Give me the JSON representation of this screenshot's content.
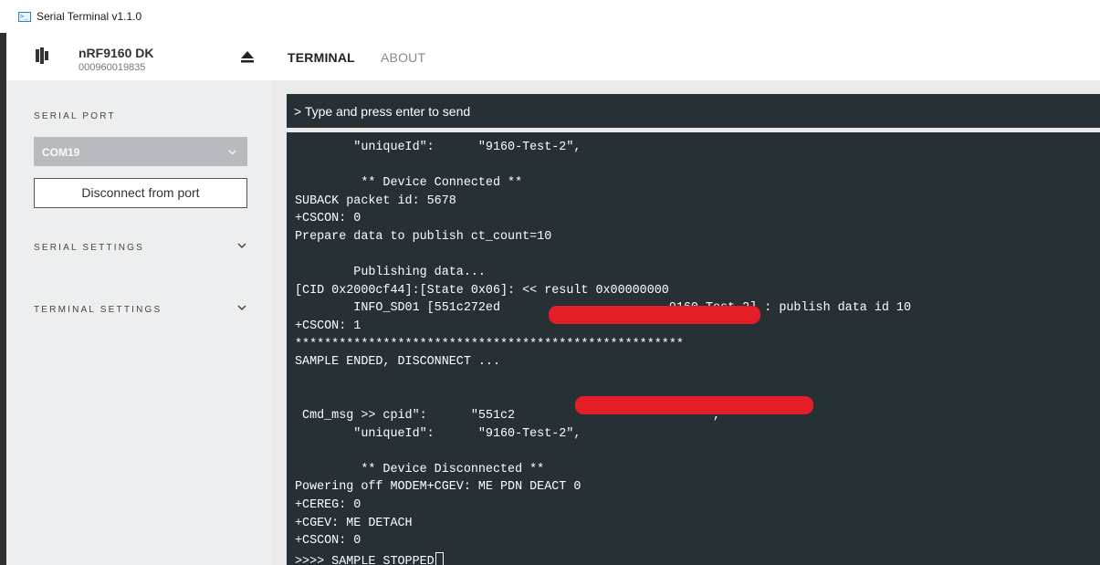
{
  "window": {
    "title": "Serial Terminal v1.1.0"
  },
  "device": {
    "name": "nRF9160 DK",
    "serial": "000960019835"
  },
  "tabs": [
    {
      "label": "TERMINAL",
      "active": true
    },
    {
      "label": "ABOUT",
      "active": false
    }
  ],
  "sidebar": {
    "serial_port_label": "SERIAL PORT",
    "port_value": "COM19",
    "disconnect_label": "Disconnect from port",
    "serial_settings_label": "SERIAL SETTINGS",
    "terminal_settings_label": "TERMINAL SETTINGS"
  },
  "terminal": {
    "input_placeholder": "> Type and press enter to send",
    "lines": [
      "        \"uniqueId\":      \"9160-Test-2\",",
      "",
      "         ** Device Connected **",
      "SUBACK packet id: 5678",
      "+CSCON: 0",
      "Prepare data to publish ct_count=10",
      "",
      "        Publishing data...",
      "[CID 0x2000cf44]:[State 0x06]: << result 0x00000000",
      "        INFO_SD01 [551c272ed                       9160-Test-2] : publish data id 10",
      "+CSCON: 1",
      "*****************************************************",
      "SAMPLE ENDED, DISCONNECT ...",
      "",
      "",
      " Cmd_msg >> cpid\":      \"551c2                          \",",
      "        \"uniqueId\":      \"9160-Test-2\",",
      "",
      "         ** Device Disconnected **",
      "Powering off MODEM+CGEV: ME PDN DEACT 0",
      "+CEREG: 0",
      "+CGEV: ME DETACH",
      "+CSCON: 0",
      ">>>> SAMPLE STOPPED"
    ]
  },
  "colors": {
    "terminal_bg": "#263035",
    "sidebar_bg": "#eceeef",
    "redaction": "#e41e26"
  },
  "icons": [
    "app-terminal-icon",
    "nordic-logo-icon",
    "eject-icon",
    "chevron-down-icon"
  ]
}
